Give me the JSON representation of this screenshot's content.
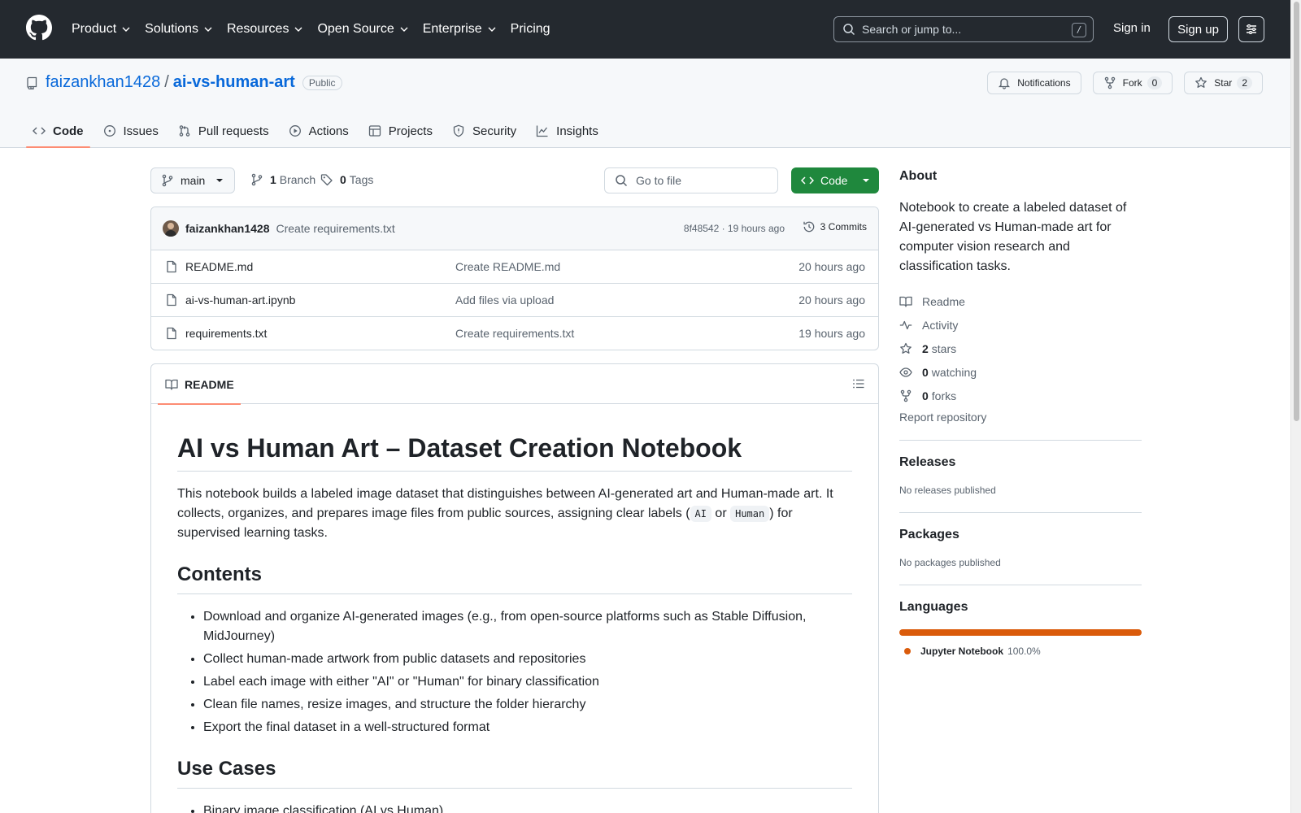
{
  "header": {
    "nav": [
      "Product",
      "Solutions",
      "Resources",
      "Open Source",
      "Enterprise",
      "Pricing"
    ],
    "search_placeholder": "Search or jump to...",
    "search_shortcut": "/",
    "sign_in": "Sign in",
    "sign_up": "Sign up"
  },
  "repo": {
    "owner": "faizankhan1428",
    "separator": "/",
    "name": "ai-vs-human-art",
    "visibility": "Public",
    "notifications_label": "Notifications",
    "fork_label": "Fork",
    "fork_count": "0",
    "star_label": "Star",
    "star_count": "2"
  },
  "tabs": [
    "Code",
    "Issues",
    "Pull requests",
    "Actions",
    "Projects",
    "Security",
    "Insights"
  ],
  "toolbar": {
    "branch": "main",
    "branches_count": "1",
    "branches_label": "Branch",
    "tags_count": "0",
    "tags_label": "Tags",
    "goto_placeholder": "Go to file",
    "code_button": "Code"
  },
  "latest_commit": {
    "author": "faizankhan1428",
    "message": "Create requirements.txt",
    "meta": "8f48542 · 19 hours ago",
    "commits": "3 Commits"
  },
  "files": [
    {
      "name": "README.md",
      "message": "Create README.md",
      "date": "20 hours ago"
    },
    {
      "name": "ai-vs-human-art.ipynb",
      "message": "Add files via upload",
      "date": "20 hours ago"
    },
    {
      "name": "requirements.txt",
      "message": "Create requirements.txt",
      "date": "19 hours ago"
    }
  ],
  "readme": {
    "tab_label": "README",
    "title": "AI vs Human Art – Dataset Creation Notebook",
    "intro_before": "This notebook builds a labeled image dataset that distinguishes between AI-generated art and Human-made art. It collects, organizes, and prepares image files from public sources, assigning clear labels (",
    "code_ai": "AI",
    "intro_or": " or ",
    "code_human": "Human",
    "intro_after": ") for supervised learning tasks.",
    "contents_heading": "Contents",
    "contents": [
      "Download and organize AI-generated images (e.g., from open-source platforms such as Stable Diffusion, MidJourney)",
      "Collect human-made artwork from public datasets and repositories",
      "Label each image with either \"AI\" or \"Human\" for binary classification",
      "Clean file names, resize images, and structure the folder hierarchy",
      "Export the final dataset in a well-structured format"
    ],
    "usecases_heading": "Use Cases",
    "usecases": [
      "Binary image classification (AI vs Human)"
    ]
  },
  "sidebar": {
    "about_heading": "About",
    "description": "Notebook to create a labeled dataset of AI-generated vs Human-made art for computer vision research and classification tasks.",
    "readme_link": "Readme",
    "activity_link": "Activity",
    "stars_count": "2",
    "stars_label": "stars",
    "watching_count": "0",
    "watching_label": "watching",
    "forks_count": "0",
    "forks_label": "forks",
    "report": "Report repository",
    "releases_heading": "Releases",
    "releases_note": "No releases published",
    "packages_heading": "Packages",
    "packages_note": "No packages published",
    "languages_heading": "Languages",
    "languages": [
      {
        "name": "Jupyter Notebook",
        "percent": "100.0%",
        "color": "#da5b0b"
      }
    ]
  },
  "colors": {
    "header_bg": "#24292f",
    "link": "#0969da",
    "primary_button": "#1f883d",
    "active_tab_underline": "#fd8c73"
  }
}
